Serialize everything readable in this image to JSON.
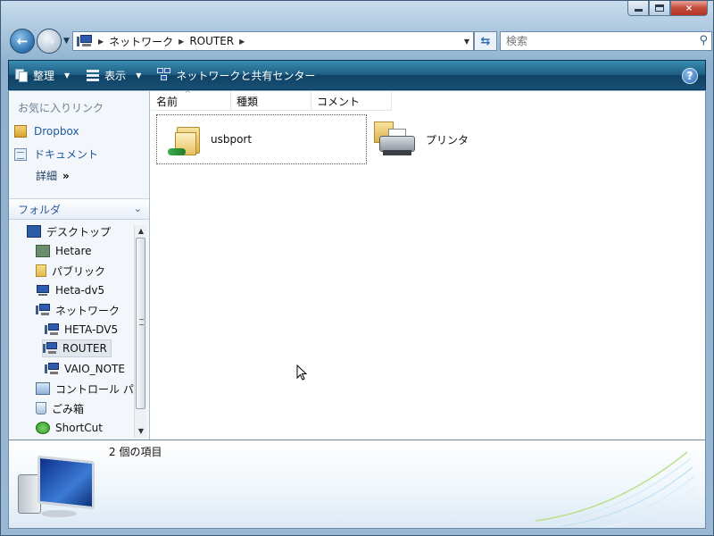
{
  "window": {
    "caption_buttons": {
      "minimize": "minimize",
      "maximize": "maximize",
      "close": "×"
    }
  },
  "navigation": {
    "breadcrumbs": [
      "ネットワーク",
      "ROUTER"
    ],
    "search_placeholder": "検索"
  },
  "toolbar": {
    "organize_label": "整理",
    "views_label": "表示",
    "network_center_label": "ネットワークと共有センター",
    "help_label": "?"
  },
  "favorites": {
    "title": "お気に入りリンク",
    "links": [
      "Dropbox",
      "ドキュメント"
    ],
    "more_label": "詳細"
  },
  "folders": {
    "header": "フォルダ",
    "tree": [
      {
        "label": "デスクトップ",
        "icon": "desktop-icon"
      },
      {
        "label": "Hetare",
        "icon": "user-folder-icon"
      },
      {
        "label": "パブリック",
        "icon": "folder-icon"
      },
      {
        "label": "Heta-dv5",
        "icon": "computer-icon"
      },
      {
        "label": "ネットワーク",
        "icon": "network-icon"
      },
      {
        "label": "HETA-DV5",
        "icon": "network-computer-icon"
      },
      {
        "label": "ROUTER",
        "icon": "network-computer-icon",
        "selected": true
      },
      {
        "label": "VAIO_NOTE",
        "icon": "network-computer-icon"
      },
      {
        "label": "コントロール パ",
        "icon": "control-panel-icon"
      },
      {
        "label": "ごみ箱",
        "icon": "recycle-bin-icon"
      },
      {
        "label": "ShortCut",
        "icon": "shortcut-icon"
      }
    ]
  },
  "columns": [
    "名前",
    "種類",
    "コメント"
  ],
  "files": [
    {
      "name": "usbport",
      "icon": "shared-folder-icon"
    },
    {
      "name": "プリンタ",
      "icon": "printer-folder-icon"
    }
  ],
  "details": {
    "item_count": "2 個の項目"
  },
  "colors": {
    "toolbar": "#1e5f84",
    "link": "#1e5aa0"
  }
}
